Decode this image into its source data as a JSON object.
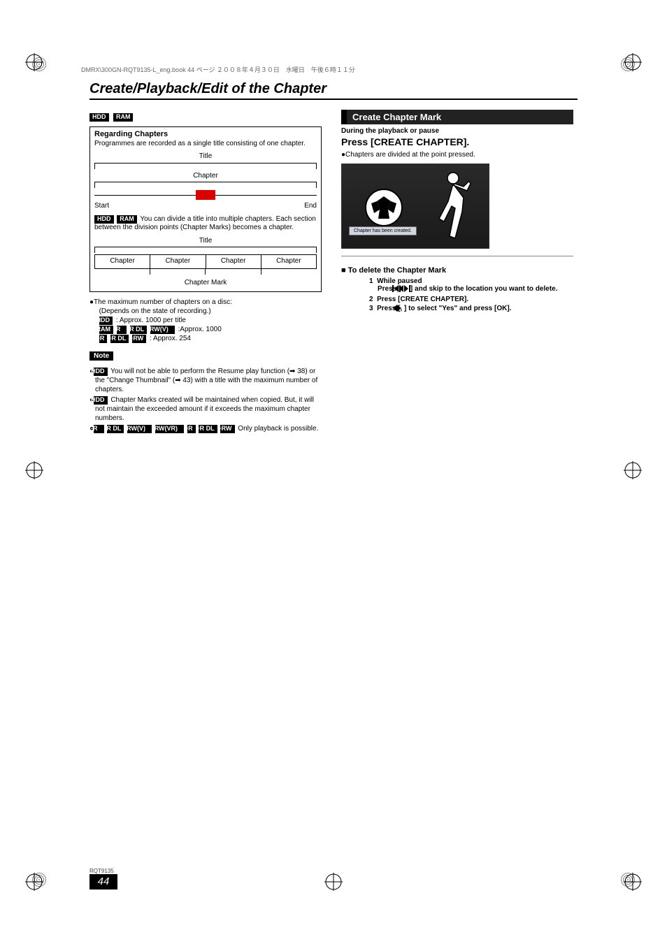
{
  "header_line": "DMRX\\300GN-RQT9135-L_eng.book  44 ページ  ２００８年４月３０日　水曜日　午後６時１１分",
  "page_title": "Create/Playback/Edit of the Chapter",
  "badges": {
    "hdd": "HDD",
    "ram": "RAM",
    "r": "-R",
    "rdl": "-R DL",
    "rwv": "-RW(V)",
    "rwvr": "-RW(VR)",
    "pr": "+R",
    "prdl": "+R DL",
    "prw": "+RW"
  },
  "left": {
    "box_title": "Regarding Chapters",
    "box_intro": "Programmes are recorded as a single title consisting of one chapter.",
    "diagram_title": "Title",
    "diagram_chapter": "Chapter",
    "start": "Start",
    "end": "End",
    "divide_text": " You can divide a title into multiple chapters. Each section between the division points (Chapter Marks) becomes a chapter.",
    "chapter_mark": "Chapter Mark",
    "max_line": "The maximum number of chapters on a disc:",
    "depends": "(Depends on the state of recording.)",
    "hdd_limit": " : Approx. 1000 per title",
    "ram_limit": " :Approx. 1000",
    "plus_limit": " : Approx. 254",
    "note_label": "Note",
    "note1_a": " You will not be able to perform the Resume play function (",
    "note1_b": " 38) or the \"Change Thumbnail\" (",
    "note1_c": " 43) with a title with the maximum number of chapters.",
    "note2": " Chapter Marks created will be maintained when copied. But, it will not maintain the exceeded amount if it exceeds the maximum chapter numbers.",
    "note3": " Only playback is possible."
  },
  "right": {
    "section_title": "Create Chapter Mark",
    "sub": "During the playback or pause",
    "instruction": "Press [CREATE CHAPTER].",
    "divided": "Chapters are divided at the point pressed.",
    "osd_msg": "Chapter has been created.",
    "delete_title": "To delete the Chapter Mark",
    "steps": {
      "s1_no": "1",
      "s1_sub": "While paused",
      "s1_text_a": "Press [",
      "s1_text_b": ", ",
      "s1_text_c": "] and skip to the location you want to delete.",
      "s2_no": "2",
      "s2_text": "Press [CREATE CHAPTER].",
      "s3_no": "3",
      "s3_text_a": "Press [",
      "s3_text_b": ", ",
      "s3_text_c": "] to select \"Yes\" and press [OK]."
    }
  },
  "footer_code": "RQT9135",
  "page_number": "44"
}
